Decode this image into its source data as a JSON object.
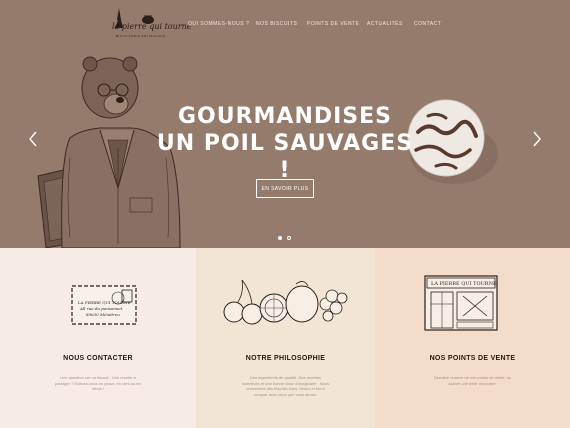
{
  "logo": {
    "title": "la pierre qui tourne",
    "subtitle": "BISCUITERIE ARTISANALE"
  },
  "nav": {
    "items": [
      "QUI SOMMES-NOUS ?",
      "NOS BISCUITS",
      "POINTS DE VENTE",
      "ACTUALITÉS",
      "CONTACT"
    ]
  },
  "hero": {
    "headline_line1": "GOURMANDISES",
    "headline_line2": "UN POIL SAUVAGES !",
    "cta": "EN SAVOIR PLUS",
    "background_color": "#957b6c",
    "slide_count": 2,
    "active_slide": 1
  },
  "features": [
    {
      "title": "NOUS CONTACTER",
      "text": "Une question sur un biscuit , Une recette à partager ? Ecrivez-nous en prose, en vers ou en rébus !",
      "background": "#f6ece5",
      "envelope_text": "LA PIERRE QUI TOURNE\nAll rue du ponsonnet\n89630 Ménétreu"
    },
    {
      "title": "NOTRE PHILOSOPHIE",
      "text": "Des ingrédients de qualité. Des recettes inventives et une bonne dose d'imaginaire . Nous concevons des biscuits bons, beaux et bio à croquer avec ceux que vous aimez.",
      "background": "#f3e5d4"
    },
    {
      "title": "NOS POINTS DE VENTE",
      "text": "Dernière chance de nos points de vente, se cacher une belle rencontre.",
      "background": "#f4dccb",
      "shop_sign": "LA PIERRE QUI TOURNE"
    }
  ]
}
